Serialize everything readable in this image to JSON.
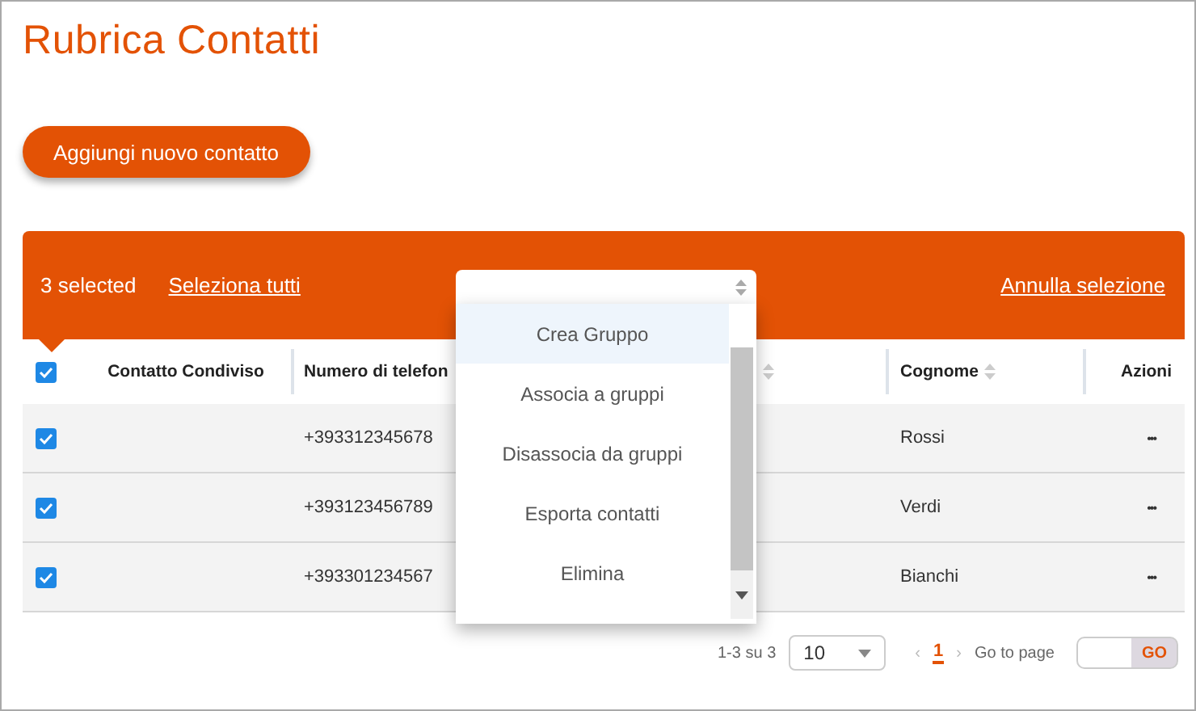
{
  "title": "Rubrica Contatti",
  "add_button": "Aggiungi nuovo contatto",
  "selection_bar": {
    "count": "3 selected",
    "select_all": "Seleziona tutti",
    "clear": "Annulla selezione"
  },
  "bulk_menu": {
    "expanded": true,
    "items": [
      {
        "label": "Crea Gruppo",
        "selected": true
      },
      {
        "label": "Associa a gruppi",
        "selected": false
      },
      {
        "label": "Disassocia da gruppi",
        "selected": false
      },
      {
        "label": "Esporta contatti",
        "selected": false
      },
      {
        "label": "Elimina",
        "selected": false
      }
    ]
  },
  "table": {
    "all_checked": true,
    "columns": [
      {
        "label": "Contatto Condiviso",
        "sortable": false
      },
      {
        "label": "Numero di telefon",
        "sortable": false
      },
      {
        "sortable": true
      },
      {
        "label": "Cognome",
        "sortable": true
      },
      {
        "label": "Azioni",
        "sortable": false
      }
    ],
    "rows": [
      {
        "checked": true,
        "phone": "+393312345678",
        "surname": "Rossi",
        "actions": "•••"
      },
      {
        "checked": true,
        "phone": "+393123456789",
        "surname": "Verdi",
        "actions": "•••"
      },
      {
        "checked": true,
        "phone": "+393301234567",
        "surname": "Bianchi",
        "actions": "•••"
      }
    ]
  },
  "pagination": {
    "range": "1-3 su 3",
    "page_size": "10",
    "previous": "‹",
    "current_page": "1",
    "next": "›",
    "go_to_label": "Go to page",
    "go_button": "GO"
  }
}
